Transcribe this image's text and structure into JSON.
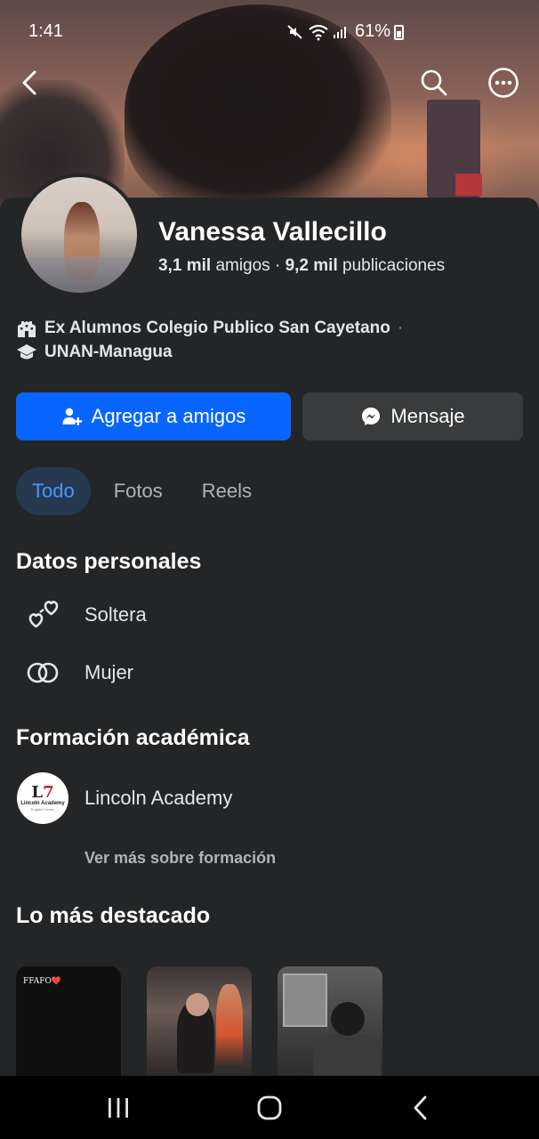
{
  "status_bar": {
    "time": "1:41",
    "battery": "61%"
  },
  "profile": {
    "name": "Vanessa Vallecillo",
    "friends_count": "3,1 mil",
    "friends_label": "amigos",
    "posts_count": "9,2 mil",
    "posts_label": "publicaciones",
    "school": "Ex Alumnos Colegio Publico San Cayetano",
    "school_sep": "·",
    "university": "UNAN-Managua"
  },
  "actions": {
    "add_friend": "Agregar a amigos",
    "message": "Mensaje"
  },
  "tabs": [
    {
      "label": "Todo",
      "active": true
    },
    {
      "label": "Fotos",
      "active": false
    },
    {
      "label": "Reels",
      "active": false
    }
  ],
  "personal": {
    "title": "Datos personales",
    "relationship": "Soltera",
    "gender": "Mujer"
  },
  "education": {
    "title": "Formación académica",
    "school_name": "Lincoln Academy",
    "logo_text": "Lincoln Academy",
    "logo_sub": "English Center",
    "see_more": "Ver más sobre formación"
  },
  "highlights": {
    "title": "Lo más destacado",
    "first_caption": "FFAFO❤️"
  },
  "colors": {
    "primary": "#0866ff",
    "tab_active_bg": "#263951",
    "tab_active_text": "#4599ff",
    "background": "#242526"
  }
}
